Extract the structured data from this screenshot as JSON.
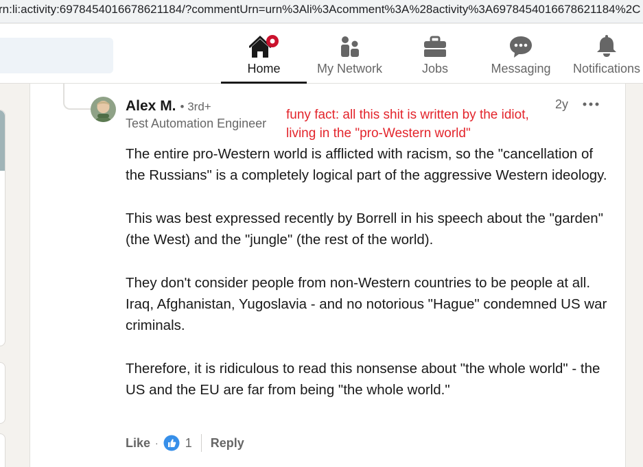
{
  "browser": {
    "url": "rn:li:activity:6978454016678621184/?commentUrn=urn%3Ali%3Acomment%3A%28activity%3A6978454016678621184%2C"
  },
  "nav": {
    "items": [
      {
        "label": "Home",
        "icon": "home-icon",
        "active": true
      },
      {
        "label": "My Network",
        "icon": "people-icon"
      },
      {
        "label": "Jobs",
        "icon": "briefcase-icon"
      },
      {
        "label": "Messaging",
        "icon": "chat-bubble-icon"
      },
      {
        "label": "Notifications",
        "icon": "bell-icon"
      }
    ]
  },
  "comment": {
    "author": "Alex M.",
    "degree": "• 3rd+",
    "headline": "Test Automation Engineer",
    "time": "2y",
    "paragraphs": [
      "The entire pro-Western world is afflicted with racism, so the \"cancellation of the Russians\" is a completely logical part of the aggressive Western ideology.",
      "This was best expressed recently by Borrell in his speech about the \"garden\" (the West) and the \"jungle\" (the rest of the world).",
      "They don't consider people from non-Western countries to be people at all. Iraq, Afghanistan, Yugoslavia - and no notorious \"Hague\" condemned US war criminals.",
      "Therefore, it is ridiculous to read this nonsense about \"the whole world\" - the US and the EU are far from being \"the whole world.\""
    ],
    "actions": {
      "like": "Like",
      "dot": "·",
      "reaction_count": "1",
      "reply": "Reply"
    }
  },
  "annotation": {
    "line1": "funy fact: all this shit is written by the idiot,",
    "line2": "living in the \"pro-Western world\""
  },
  "colors": {
    "annotation": "#e3242b",
    "notification_badge": "#cb112d",
    "like_blue": "#378fe9"
  }
}
